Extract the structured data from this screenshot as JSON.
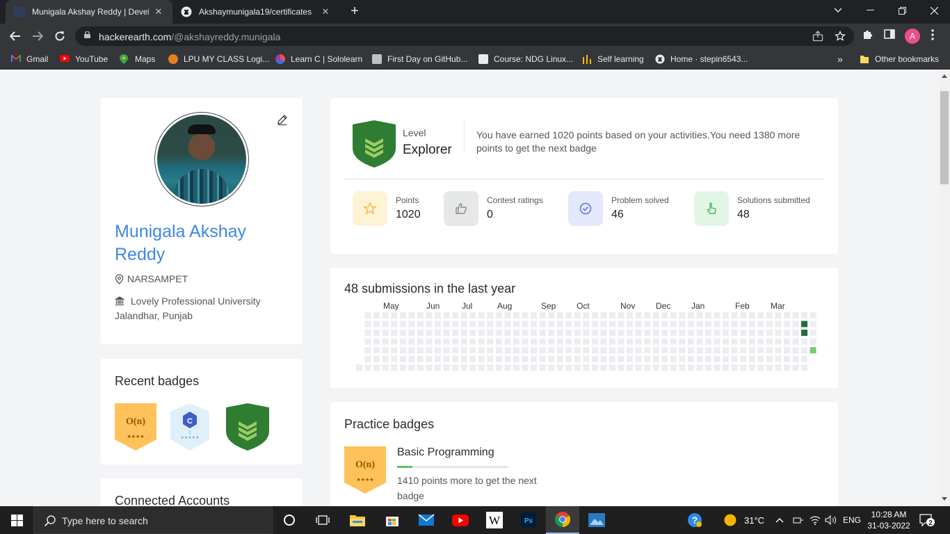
{
  "browser": {
    "tabs": [
      {
        "title": "Munigala Akshay Reddy | Develo",
        "active": true
      },
      {
        "title": "Akshaymunigala19/certificates",
        "active": false
      }
    ],
    "url_host": "hackerearth.com",
    "url_path": "/@akshayreddy.munigala",
    "profile_initial": "A",
    "bookmarks": [
      "Gmail",
      "YouTube",
      "Maps",
      "LPU MY CLASS Logi...",
      "Learn C | Sololearn",
      "First Day on GitHub...",
      "Course: NDG Linux...",
      "Self learning",
      "Home · stepin6543..."
    ],
    "other_bookmarks": "Other bookmarks",
    "more_bookmarks": "»"
  },
  "profile": {
    "name": "Munigala Akshay Reddy",
    "location": "NARSAMPET",
    "university": "Lovely Professional University Jalandhar, Punjab"
  },
  "recent_badges": {
    "title": "Recent badges",
    "badge1_text": "O(n)",
    "badge1_stars": "★★★★",
    "badge2_text": "C",
    "badge2_sub": "C",
    "badge2_stars": "★★★★★"
  },
  "connected_accounts": {
    "title": "Connected Accounts"
  },
  "level": {
    "label": "Level",
    "value": "Explorer",
    "message": "You have earned 1020 points based on your activities.You need 1380 more points to get the next badge"
  },
  "stats": [
    {
      "label": "Points",
      "value": "1020"
    },
    {
      "label": "Contest ratings",
      "value": "0"
    },
    {
      "label": "Problem solved",
      "value": "46"
    },
    {
      "label": "Solutions submitted",
      "value": "48"
    }
  ],
  "activity": {
    "title": "48 submissions in the last year",
    "months": [
      "May",
      "Jun",
      "Jul",
      "Aug",
      "Sep",
      "Oct",
      "Nov",
      "Dec",
      "Jan",
      "Feb",
      "Mar"
    ]
  },
  "practice": {
    "title": "Practice badges",
    "badge_text": "O(n)",
    "badge_stars": "★★★★",
    "name": "Basic Programming",
    "progress": 0.14,
    "message": "1410 points more to get the next badge"
  },
  "taskbar": {
    "search_placeholder": "Type here to search",
    "weather": "31°C",
    "lang": "ENG",
    "time": "10:28 AM",
    "date": "31-03-2022",
    "notifications": "2"
  },
  "colors": {
    "accent_blue": "#3f87e6",
    "badge_orange": "#ffc15a",
    "badge_green": "#2e7d32",
    "heat_dark": "#216e39",
    "heat_light": "#7bc96f",
    "heat_empty": "#ebedf0"
  }
}
